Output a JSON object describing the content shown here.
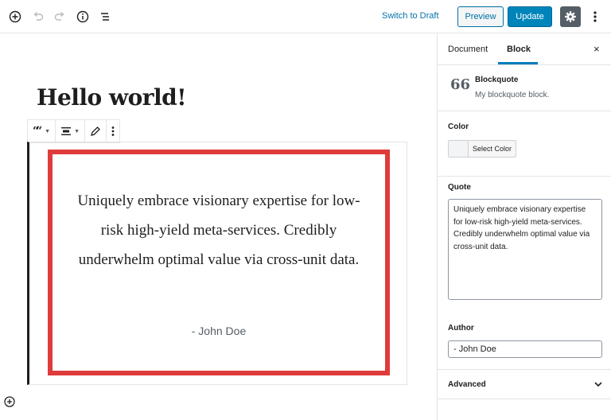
{
  "toolbar": {
    "switch_to_draft": "Switch to Draft",
    "preview": "Preview",
    "update": "Update",
    "icons": [
      "add-block-icon",
      "undo-icon",
      "redo-icon",
      "info-icon",
      "list-view-icon",
      "gear-icon",
      "more-vertical-icon"
    ]
  },
  "editor": {
    "title": "Hello world!",
    "quote_text": "Uniquely embrace visionary expertise for low-risk high-yield meta-services. Credibly underwhelm optimal value via cross-unit data.",
    "citation": "- John Doe",
    "block_toolbar_icons": [
      "quote-icon",
      "align-icon",
      "pencil-icon",
      "more-vertical-icon"
    ]
  },
  "sidebar": {
    "tabs": [
      {
        "label": "Document"
      },
      {
        "label": "Block",
        "active": true
      }
    ],
    "close_glyph": "×",
    "block": {
      "icon_glyph": "66",
      "name": "Blockquote",
      "description": "My blockquote block."
    },
    "color": {
      "label": "Color",
      "select_label": "Select Color"
    },
    "quote": {
      "label": "Quote",
      "value": "Uniquely embrace visionary expertise for low-risk high-yield meta-services. Credibly underwhelm optimal value via cross-unit data."
    },
    "author": {
      "label": "Author",
      "value": "- John Doe"
    },
    "advanced": {
      "label": "Advanced"
    }
  },
  "colors": {
    "accent": "#0085ba",
    "highlight_border": "#e03b3b",
    "tab_underline": "#007cba"
  }
}
